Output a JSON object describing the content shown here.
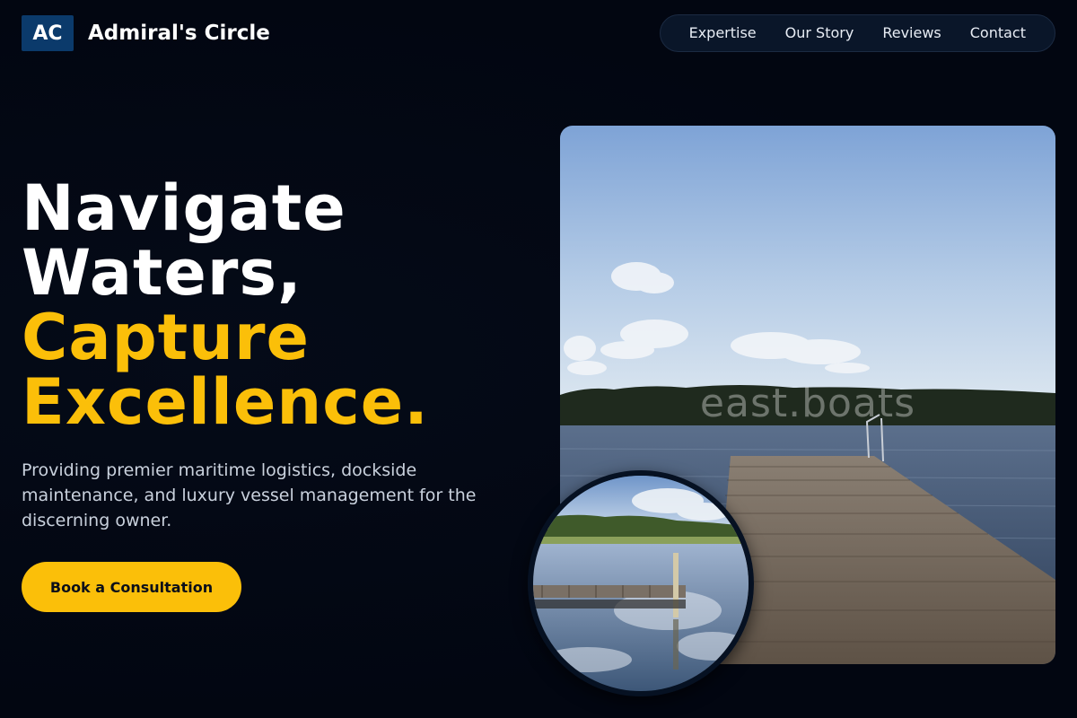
{
  "header": {
    "logo_initials": "AC",
    "brand_name": "Admiral's Circle",
    "nav": [
      {
        "label": "Expertise"
      },
      {
        "label": "Our Story"
      },
      {
        "label": "Reviews"
      },
      {
        "label": "Contact"
      }
    ]
  },
  "hero": {
    "title_line1": "Navigate",
    "title_line2": "Waters,",
    "title_line3": "Capture",
    "title_line4": "Excellence.",
    "subtitle": "Providing premier maritime logistics, dockside maintenance, and luxury vessel management for the discerning owner.",
    "cta_label": "Book a Consultation"
  },
  "media": {
    "main_watermark": "east.boats"
  },
  "colors": {
    "background": "#020611",
    "accent": "#fbbf09",
    "logo_box": "#0b3a6b",
    "nav_bg": "#0a1629"
  }
}
